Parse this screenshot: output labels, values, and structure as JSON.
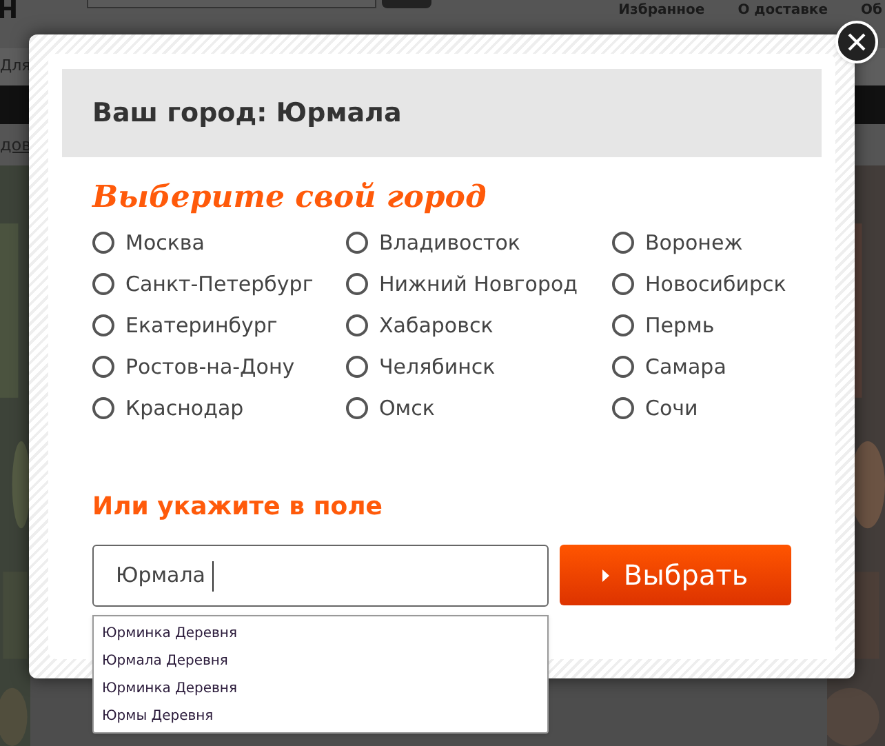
{
  "page": {
    "logo_fragment": "Н",
    "nav": [
      "Избранное",
      "О доставке",
      "Об"
    ],
    "category_fragment": "Для",
    "link_fragment": "дов"
  },
  "dialog": {
    "title": "Ваш город: Юрмала",
    "heading": "Выберите свой город",
    "cities": [
      {
        "label": "Москва",
        "selected": false
      },
      {
        "label": "Владивосток",
        "selected": false
      },
      {
        "label": "Воронеж",
        "selected": false
      },
      {
        "label": "Санкт-Петербург",
        "selected": false
      },
      {
        "label": "Нижний Новгород",
        "selected": false
      },
      {
        "label": "Новосибирск",
        "selected": false
      },
      {
        "label": "Екатеринбург",
        "selected": false
      },
      {
        "label": "Хабаровск",
        "selected": false
      },
      {
        "label": "Пермь",
        "selected": false
      },
      {
        "label": "Ростов-на-Дону",
        "selected": false
      },
      {
        "label": "Челябинск",
        "selected": false
      },
      {
        "label": "Самара",
        "selected": false
      },
      {
        "label": "Краснодар",
        "selected": false
      },
      {
        "label": "Омск",
        "selected": false
      },
      {
        "label": "Сочи",
        "selected": false
      }
    ],
    "field_heading": "Или укажите в поле",
    "field": {
      "value": "Юрмала"
    },
    "submit": "Выбрать",
    "suggestions": [
      "Юрминка Деревня",
      "Юрмала Деревня",
      "Юрминка Деревня",
      "Юрмы Деревня"
    ]
  }
}
